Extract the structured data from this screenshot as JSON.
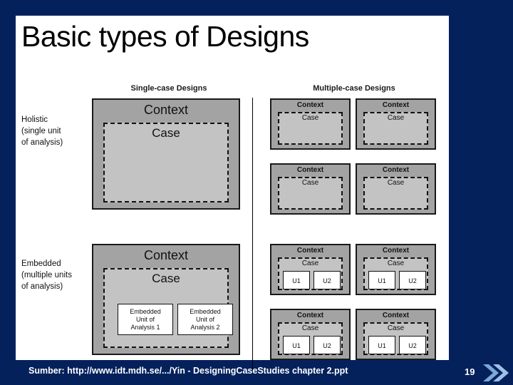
{
  "slide": {
    "title": "Basic types of Designs",
    "background_color": "#04215c",
    "card_color": "#ffffff"
  },
  "diagram": {
    "column_headers": {
      "single": "Single-case Designs",
      "multiple": "Multiple-case Designs"
    },
    "row_labels": {
      "holistic": "Holistic\n(single unit\nof analysis)",
      "holistic_line1": "Holistic",
      "holistic_line2": "(single unit",
      "holistic_line3": "of analysis)",
      "embedded_line1": "Embedded",
      "embedded_line2": "(multiple units",
      "embedded_line3": "of analysis)"
    },
    "labels": {
      "context": "Context",
      "case": "Case",
      "embedded_unit_1": "Embedded\nUnit of\nAnalysis 1",
      "embedded_unit_2": "Embedded\nUnit of\nAnalysis 2",
      "eu1_line1": "Embedded",
      "eu1_line2": "Unit of",
      "eu1_line3": "Analysis 1",
      "eu2_line1": "Embedded",
      "eu2_line2": "Unit of",
      "eu2_line3": "Analysis 2",
      "u1": "U1",
      "u2": "U2"
    },
    "colors": {
      "context_fill": "#a3a3a3",
      "case_fill": "#c3c3c3",
      "unit_fill": "#ffffff",
      "stroke": "#111111"
    },
    "quadrants": {
      "holistic_single": {
        "context": "Context",
        "case": "Case"
      },
      "holistic_multiple_count": 4,
      "embedded_single": {
        "context": "Context",
        "case": "Case"
      },
      "embedded_multiple_count": 4
    }
  },
  "footer": {
    "source_text": "Sumber: http://www.idt.mdh.se/.../Yin - DesigningCaseStudies chapter 2.ppt",
    "page_number": "19",
    "chevron_color": "#8db4e2"
  }
}
